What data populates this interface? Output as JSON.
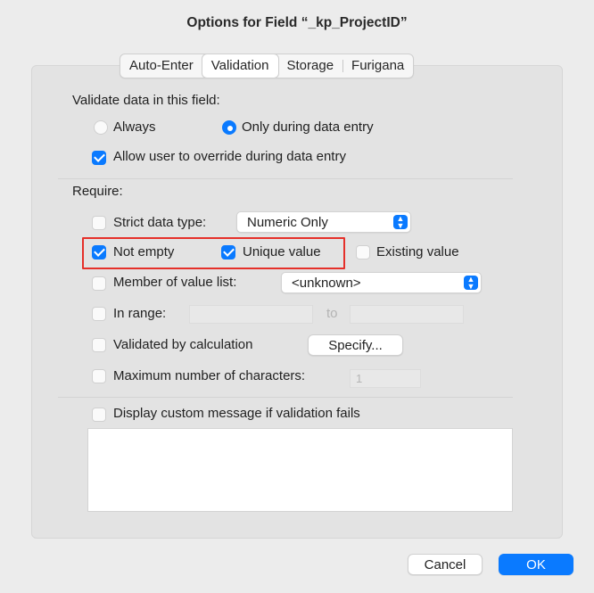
{
  "dialog": {
    "title": "Options for Field “_kp_ProjectID”"
  },
  "tabs": [
    {
      "label": "Auto-Enter",
      "active": false
    },
    {
      "label": "Validation",
      "active": true
    },
    {
      "label": "Storage",
      "active": false
    },
    {
      "label": "Furigana",
      "active": false
    }
  ],
  "validate": {
    "heading": "Validate data in this field:",
    "always_label": "Always",
    "always_selected": false,
    "entry_label": "Only during data entry",
    "entry_selected": true,
    "override_label": "Allow user to override during data entry",
    "override_checked": true
  },
  "require": {
    "heading": "Require:",
    "strict_label": "Strict data type:",
    "strict_checked": false,
    "strict_value": "Numeric Only",
    "not_empty_label": "Not empty",
    "not_empty_checked": true,
    "unique_label": "Unique value",
    "unique_checked": true,
    "existing_label": "Existing value",
    "existing_checked": false,
    "member_label": "Member of value list:",
    "member_checked": false,
    "member_value": "<unknown>",
    "range_label": "In range:",
    "range_checked": false,
    "range_to": "to",
    "calc_label": "Validated by calculation",
    "calc_checked": false,
    "specify_label": "Specify...",
    "max_label": "Maximum number of characters:",
    "max_checked": false,
    "max_value": "1"
  },
  "custom_message": {
    "label": "Display custom message if validation fails",
    "checked": false
  },
  "footer": {
    "cancel_label": "Cancel",
    "ok_label": "OK"
  },
  "colors": {
    "accent": "#0a7aff",
    "highlight": "#e5302a"
  }
}
